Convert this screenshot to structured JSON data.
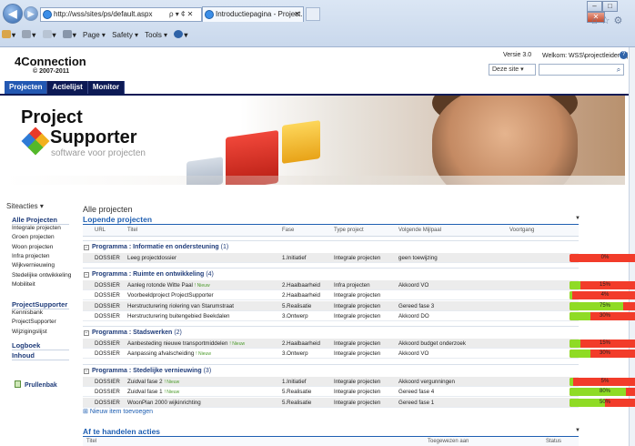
{
  "browser": {
    "address": "http://wss/sites/ps/default.aspx",
    "address_controls": "ρ ▾ ¢ ✕",
    "tab_title": "Introductiepagina - Project...",
    "tab_close": "✕",
    "window_buttons": [
      "–",
      "□",
      "✕"
    ],
    "toolbar_icons": [
      "home-icon",
      "star-icon",
      "gear-icon"
    ],
    "command_bar": {
      "home": "▾",
      "feeds": "▾",
      "mail": "▾",
      "print": "▾",
      "page": "Page ▾",
      "safety": "Safety ▾",
      "tools": "Tools ▾",
      "help": "▾"
    }
  },
  "header": {
    "brand": "4Connection",
    "copyright": "© 2007-2011",
    "version": "Versie 3.0",
    "welcome": "Welkom: WSS\\projectleider ▾ |",
    "search_scope": "Deze site  ▾",
    "search_placeholder": ""
  },
  "topnav": [
    {
      "label": "Projecten",
      "selected": true
    },
    {
      "label": "Actielijst",
      "selected": false
    },
    {
      "label": "Monitor",
      "selected": false
    }
  ],
  "banner": {
    "line1": "Project",
    "line2": "Supporter",
    "tagline": "software voor projecten"
  },
  "leftnav": {
    "siteacties": "Siteacties ▾",
    "groups": [
      {
        "heading": "Alle Projecten",
        "items": [
          "Integrale projecten",
          "Groen projecten",
          "Woon projecten",
          "Infra projecten",
          "Wijkvernieuwing",
          "Stedelijke ontwikkeling",
          "Mobiliteit"
        ]
      },
      {
        "heading": "ProjectSupporter",
        "items": [
          "Kennisbank",
          "ProjectSupporter",
          "Wijzigingslijst"
        ]
      },
      {
        "heading": "Logboek",
        "items": []
      },
      {
        "heading": "Inhoud",
        "items": []
      }
    ],
    "recycle": "Prullenbak"
  },
  "main": {
    "title": "Alle projecten",
    "section1": "Lopende projecten",
    "columns": [
      "URL",
      "Titel",
      "Fase",
      "Type project",
      "Volgende Mijlpaal",
      "Voortgang"
    ],
    "groups": [
      {
        "label": "Programma : Informatie en ondersteuning",
        "count": "(1)",
        "rows": [
          {
            "url": "DOSSIER",
            "title": "Leeg projectdossier",
            "nieuw": "",
            "fase": "1.Initiatief",
            "type": "Integrale projecten",
            "mijlpaal": "geen toewijzing",
            "progress": 0,
            "progress_label": "0%"
          }
        ]
      },
      {
        "label": "Programma : Ruimte en ontwikkeling",
        "count": "(4)",
        "rows": [
          {
            "url": "DOSSIER",
            "title": "Aanleg rotonde Witte Paal",
            "nieuw": "! Nieuw",
            "fase": "2.Haalbaarheid",
            "type": "Infra projecten",
            "mijlpaal": "Akkoord VO",
            "progress": 15,
            "progress_label": "15%"
          },
          {
            "url": "DOSSIER",
            "title": "Voorbeeldproject ProjectSupporter",
            "nieuw": "",
            "fase": "2.Haalbaarheid",
            "type": "Integrale projecten",
            "mijlpaal": "",
            "progress": 4,
            "progress_label": "4%"
          },
          {
            "url": "DOSSIER",
            "title": "Herstructurering riolering van Starumstraat",
            "nieuw": "",
            "fase": "5.Realisatie",
            "type": "Integrale projecten",
            "mijlpaal": "Gereed fase 3",
            "progress": 75,
            "progress_label": "75%"
          },
          {
            "url": "DOSSIER",
            "title": "Herstructurering buitengebied Beekdalen",
            "nieuw": "",
            "fase": "3.Ontwerp",
            "type": "Integrale projecten",
            "mijlpaal": "Akkoord DO",
            "progress": 30,
            "progress_label": "30%"
          }
        ]
      },
      {
        "label": "Programma : Stadswerken",
        "count": "(2)",
        "rows": [
          {
            "url": "DOSSIER",
            "title": "Aanbesteding nieuwe transportmiddelen",
            "nieuw": "! Nieuw",
            "fase": "2.Haalbaarheid",
            "type": "Integrale projecten",
            "mijlpaal": "Akkoord budget onderzoek",
            "progress": 15,
            "progress_label": "15%"
          },
          {
            "url": "DOSSIER",
            "title": "Aanpassing afvalscheiding",
            "nieuw": "! Nieuw",
            "fase": "3.Ontwerp",
            "type": "Integrale projecten",
            "mijlpaal": "Akkoord VO",
            "progress": 30,
            "progress_label": "30%"
          }
        ]
      },
      {
        "label": "Programma : Stedelijke vernieuwing",
        "count": "(3)",
        "rows": [
          {
            "url": "DOSSIER",
            "title": "Zuidval fase 2",
            "nieuw": "! Nieuw",
            "fase": "1.Initiatief",
            "type": "Integrale projecten",
            "mijlpaal": "Akkoord vergunningen",
            "progress": 5,
            "progress_label": "5%"
          },
          {
            "url": "DOSSIER",
            "title": "Zuidval fase 1",
            "nieuw": "! Nieuw",
            "fase": "5.Realisatie",
            "type": "Integrale projecten",
            "mijlpaal": "Gereed fase 4",
            "progress": 80,
            "progress_label": "80%"
          },
          {
            "url": "DOSSIER",
            "title": "WoonPlan 2000 wijkinrichting",
            "nieuw": "",
            "fase": "5.Realisatie",
            "type": "Integrale projecten",
            "mijlpaal": "Gereed fase 1",
            "progress": 50,
            "progress_label": "50%"
          }
        ]
      }
    ],
    "new_item": "Nieuw item toevoegen",
    "section2": "Af te handelen acties",
    "columns2": [
      "Titel",
      "Toegewezen aan",
      "Status"
    ]
  },
  "colors": {
    "nav_bg": "#0d1a55",
    "nav_selected": "#2358b2",
    "link": "#1f5fb2",
    "progress_red": "#f23c2a",
    "progress_green": "#8fdb25"
  }
}
